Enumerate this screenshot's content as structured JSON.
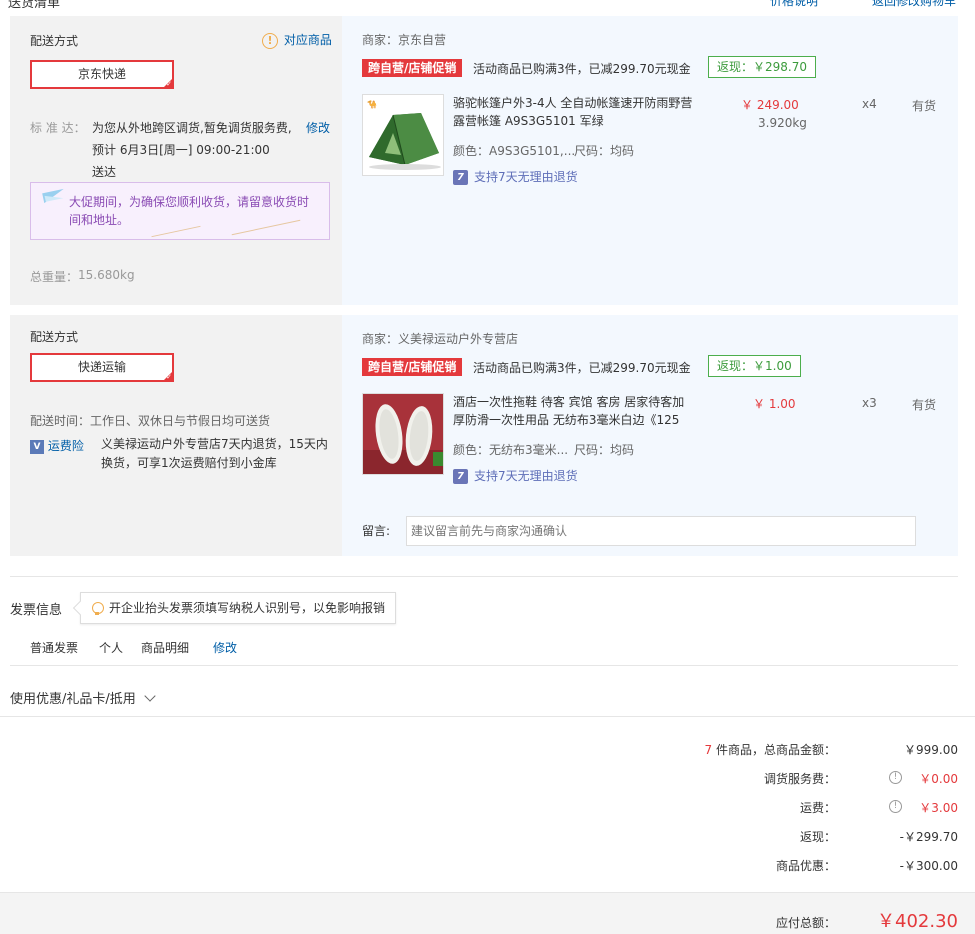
{
  "top": {
    "left_text": "送货清单",
    "link1": "价格说明",
    "link2": "返回修改购物车"
  },
  "packages": [
    {
      "ship_method_label": "配送方式",
      "related_goods": "对应商品",
      "ship_option": "京东快递",
      "standard_label": "标 准 达：",
      "standard_text": "为您从外地跨区调货,暂免调货服务费,",
      "modify": "修改",
      "eta_line1": "预计 6月3日[周一] 09:00-21:00",
      "eta_line2": "送达",
      "notice": "大促期间，为确保您顺利收货，请留意收货时间和地址。",
      "weight_label": "总重量：",
      "weight": "15.680kg",
      "merchant_label": "商家：",
      "merchant": "京东自营",
      "promo_tag": "跨自营/店铺促销",
      "promo_text": "活动商品已购满3件，已减299.70元现金",
      "rebate": "返现：￥298.70",
      "product": {
        "name": "骆驼帐篷户外3-4人 全自动帐篷速开防雨野营露营帐篷 A9S3G5101 军绿",
        "price": "￥ 249.00",
        "unit_weight": "3.920kg",
        "qty": "x4",
        "stock": "有货",
        "color_attr": "颜色：A9S3G5101,...",
        "size_attr": "尺码：均码",
        "return_policy": "支持7天无理由退货"
      }
    },
    {
      "ship_method_label": "配送方式",
      "ship_option": "快递运输",
      "delivery_time": "配送时间：工作日、双休日与节假日均可送货",
      "insurance_label": "运费险",
      "insurance_text": "义美禄运动户外专营店7天内退货，15天内换货，可享1次运费赔付到小金库",
      "merchant_label": "商家：",
      "merchant": "义美禄运动户外专营店",
      "promo_tag": "跨自营/店铺促销",
      "promo_text": "活动商品已购满3件，已减299.70元现金",
      "rebate": "返现：￥1.00",
      "product": {
        "name": "酒店一次性拖鞋 待客 宾馆 客房 居家待客加厚防滑一次性用品 无纺布3毫米白边《125",
        "price": "￥ 1.00",
        "qty": "x3",
        "stock": "有货",
        "color_attr": "颜色：无纺布3毫米...",
        "size_attr": "尺码：均码",
        "return_policy": "支持7天无理由退货"
      },
      "message_label": "留言:",
      "message_placeholder": "建议留言前先与商家沟通确认"
    }
  ],
  "invoice": {
    "title": "发票信息",
    "tip": "开企业抬头发票须填写纳税人识别号，以免影响报销",
    "type": "普通发票",
    "header": "个人",
    "content": "商品明细",
    "modify": "修改"
  },
  "coupons": {
    "title": "使用优惠/礼品卡/抵用"
  },
  "summary": {
    "count": "7",
    "count_suffix": "件商品，总商品金额：",
    "goods_total": "￥999.00",
    "transfer_fee_label": "调货服务费：",
    "transfer_fee": "￥0.00",
    "freight_label": "运费：",
    "freight": "￥3.00",
    "rebate_label": "返现：",
    "rebate": "-￥299.70",
    "discount_label": "商品优惠：",
    "discount": "-￥300.00",
    "payable_label": "应付总额：",
    "payable": "￥402.30"
  }
}
